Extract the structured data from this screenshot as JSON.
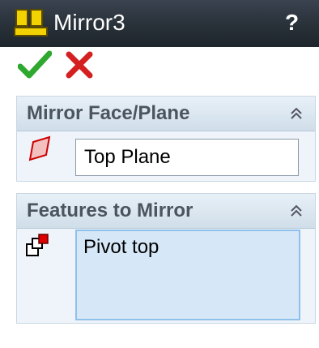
{
  "titlebar": {
    "title": "Mirror3",
    "help_label": "?",
    "icon": "mirror-feature-icon"
  },
  "actions": {
    "ok_icon": "green-checkmark-icon",
    "cancel_icon": "red-x-icon"
  },
  "sections": {
    "mirror_plane": {
      "title": "Mirror Face/Plane",
      "icon": "plane-icon",
      "value": "Top Plane"
    },
    "features": {
      "title": "Features to Mirror",
      "icon": "features-icon",
      "items": [
        "Pivot top"
      ]
    }
  },
  "colors": {
    "titlebar": "#283038",
    "panel": "#eef4fa",
    "selection_box": "#d6e8f8",
    "ok": "#2ea82e",
    "cancel": "#d42020"
  }
}
